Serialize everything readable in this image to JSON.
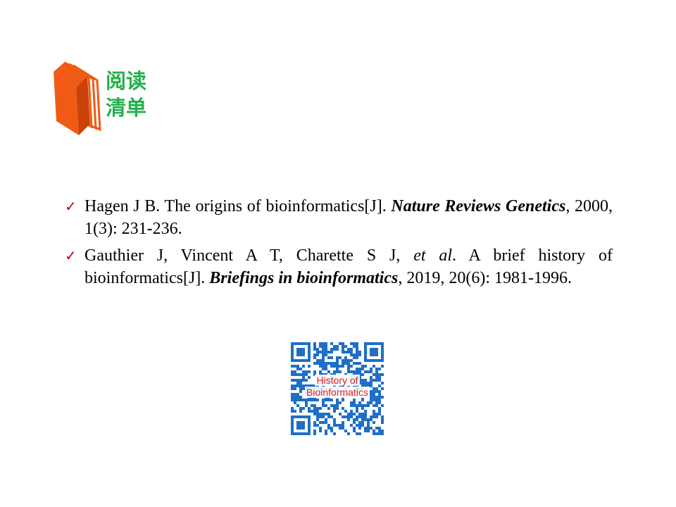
{
  "logo": {
    "line1": "阅读",
    "line2": "清单",
    "text_color": "#22b14c",
    "book_color": "#f05a14",
    "icon": "book-icon"
  },
  "references": [
    {
      "mark": "✓",
      "authors": "Hagen J B. The origins of bioinformatics[J]. ",
      "journal": "Nature Reviews Genetics",
      "rest": ", 2000, 1(3): 231-236."
    },
    {
      "mark": "✓",
      "authors": "Gauthier J, Vincent A T, Charette S J, ",
      "etal": "et al",
      "authors_after": ". A brief history of bioinformatics[J]. ",
      "journal": "Briefings in bioinformatics",
      "rest": ", 2019, 20(6): 1981-1996."
    }
  ],
  "qr": {
    "label_line1": "History of",
    "label_line2": "Bioinformatics",
    "module_color": "#1f6fc6",
    "label_color": "#e8201f"
  }
}
